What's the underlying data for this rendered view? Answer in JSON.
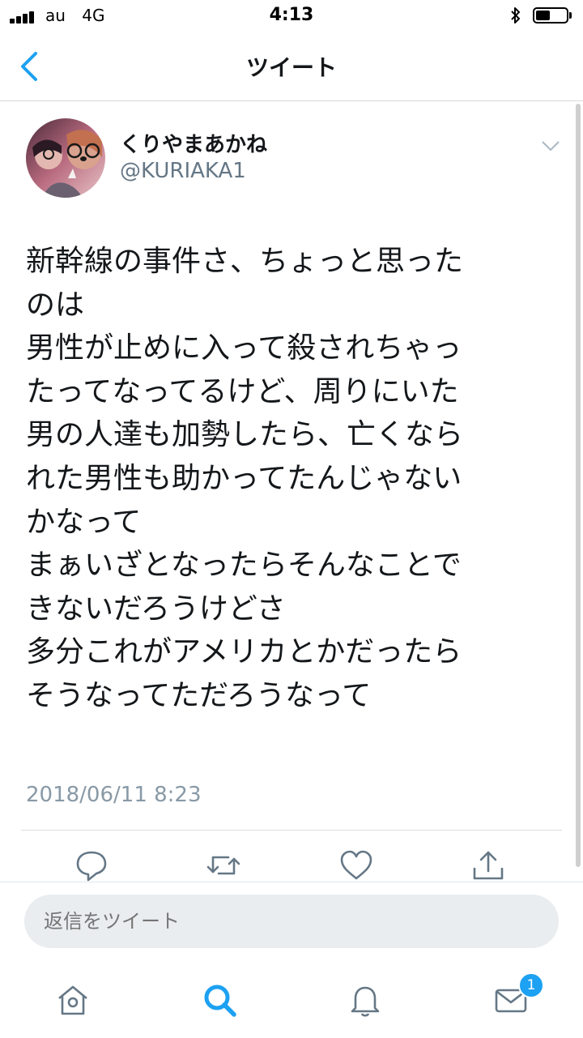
{
  "status_bar": {
    "carrier": "au",
    "network": "4G",
    "time": "4:13"
  },
  "nav": {
    "title": "ツイート"
  },
  "tweet": {
    "display_name": "くりやまあかね",
    "handle": "@KURIAKA1",
    "lines": [
      "新幹線の事件さ、ちょっと思った",
      "のは",
      "男性が止めに入って殺されちゃっ",
      "たってなってるけど、周りにいた",
      "男の人達も加勢したら、亡くなら",
      "れた男性も助かってたんじゃない",
      "かなって",
      "まぁいざとなったらそんなことで",
      "きないだろうけどさ",
      "多分これがアメリカとかだったら",
      "そうなってただろうなって"
    ],
    "timestamp": "2018/06/11 8:23"
  },
  "actions": [
    "reply-icon",
    "retweet-icon",
    "like-icon",
    "share-icon"
  ],
  "reply": {
    "placeholder": "返信をツイート"
  },
  "tabbar": {
    "messages_badge": "1"
  },
  "colors": {
    "accent": "#1da1f2",
    "icon_gray": "#657786",
    "text": "#14171a",
    "muted": "#8899a6"
  }
}
